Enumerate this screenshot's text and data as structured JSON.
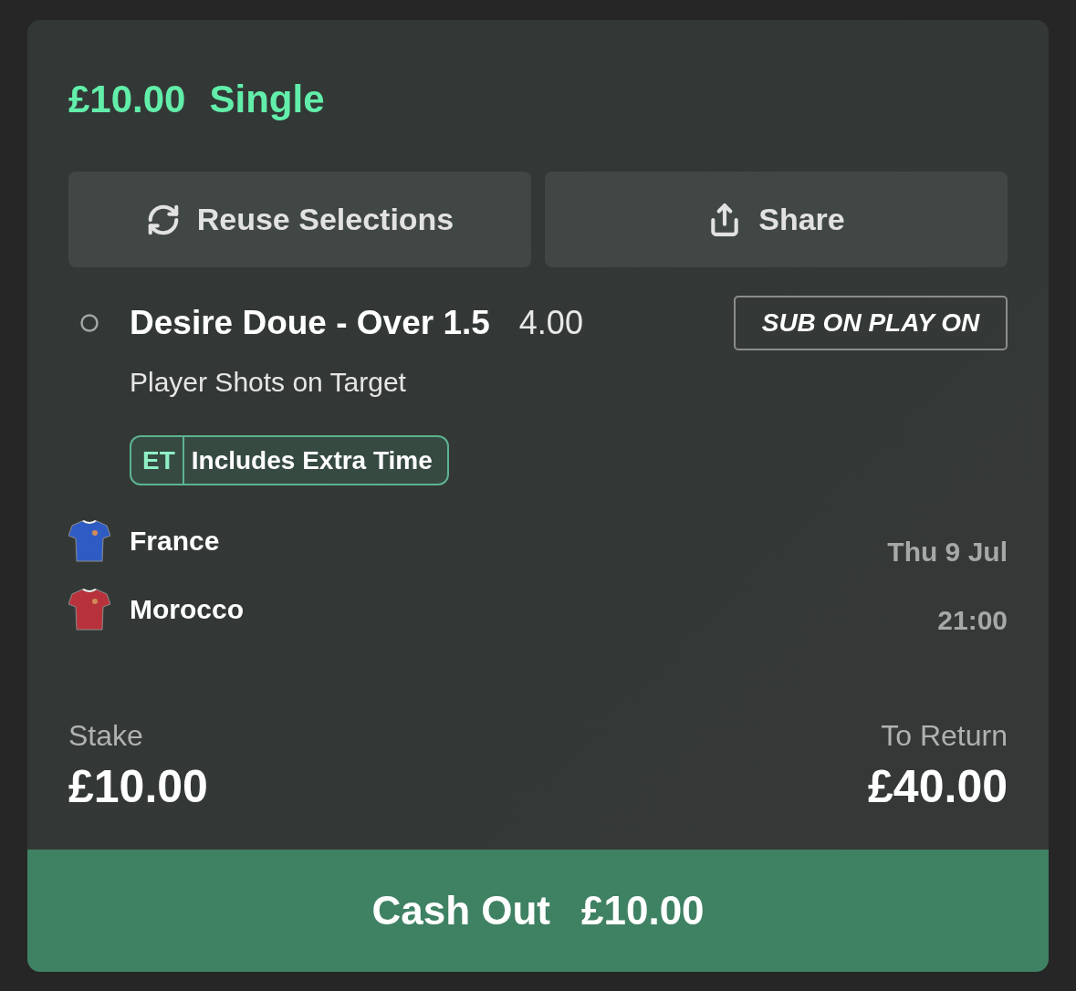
{
  "bet": {
    "stake_amount": "£10.00",
    "bet_type": "Single"
  },
  "actions": [
    {
      "kind": "reuse",
      "label": "Reuse Selections"
    },
    {
      "kind": "share",
      "label": "Share"
    }
  ],
  "selection": {
    "title": "Desire Doue - Over 1.5",
    "odds": "4.00",
    "promo_badge": "SUB ON PLAY ON",
    "market": "Player Shots on Target",
    "extra_time_badge": {
      "code": "ET",
      "label": "Includes Extra Time"
    }
  },
  "match": {
    "teams": [
      {
        "name": "France",
        "color": "#2f5cc4"
      },
      {
        "name": "Morocco",
        "color": "#b8323c"
      }
    ],
    "date": "Thu 9 Jul",
    "time": "21:00"
  },
  "summary": {
    "stake_label": "Stake",
    "stake": "£10.00",
    "return_label": "To Return",
    "return": "£40.00"
  },
  "cash_out": {
    "label": "Cash Out",
    "amount": "£10.00"
  }
}
